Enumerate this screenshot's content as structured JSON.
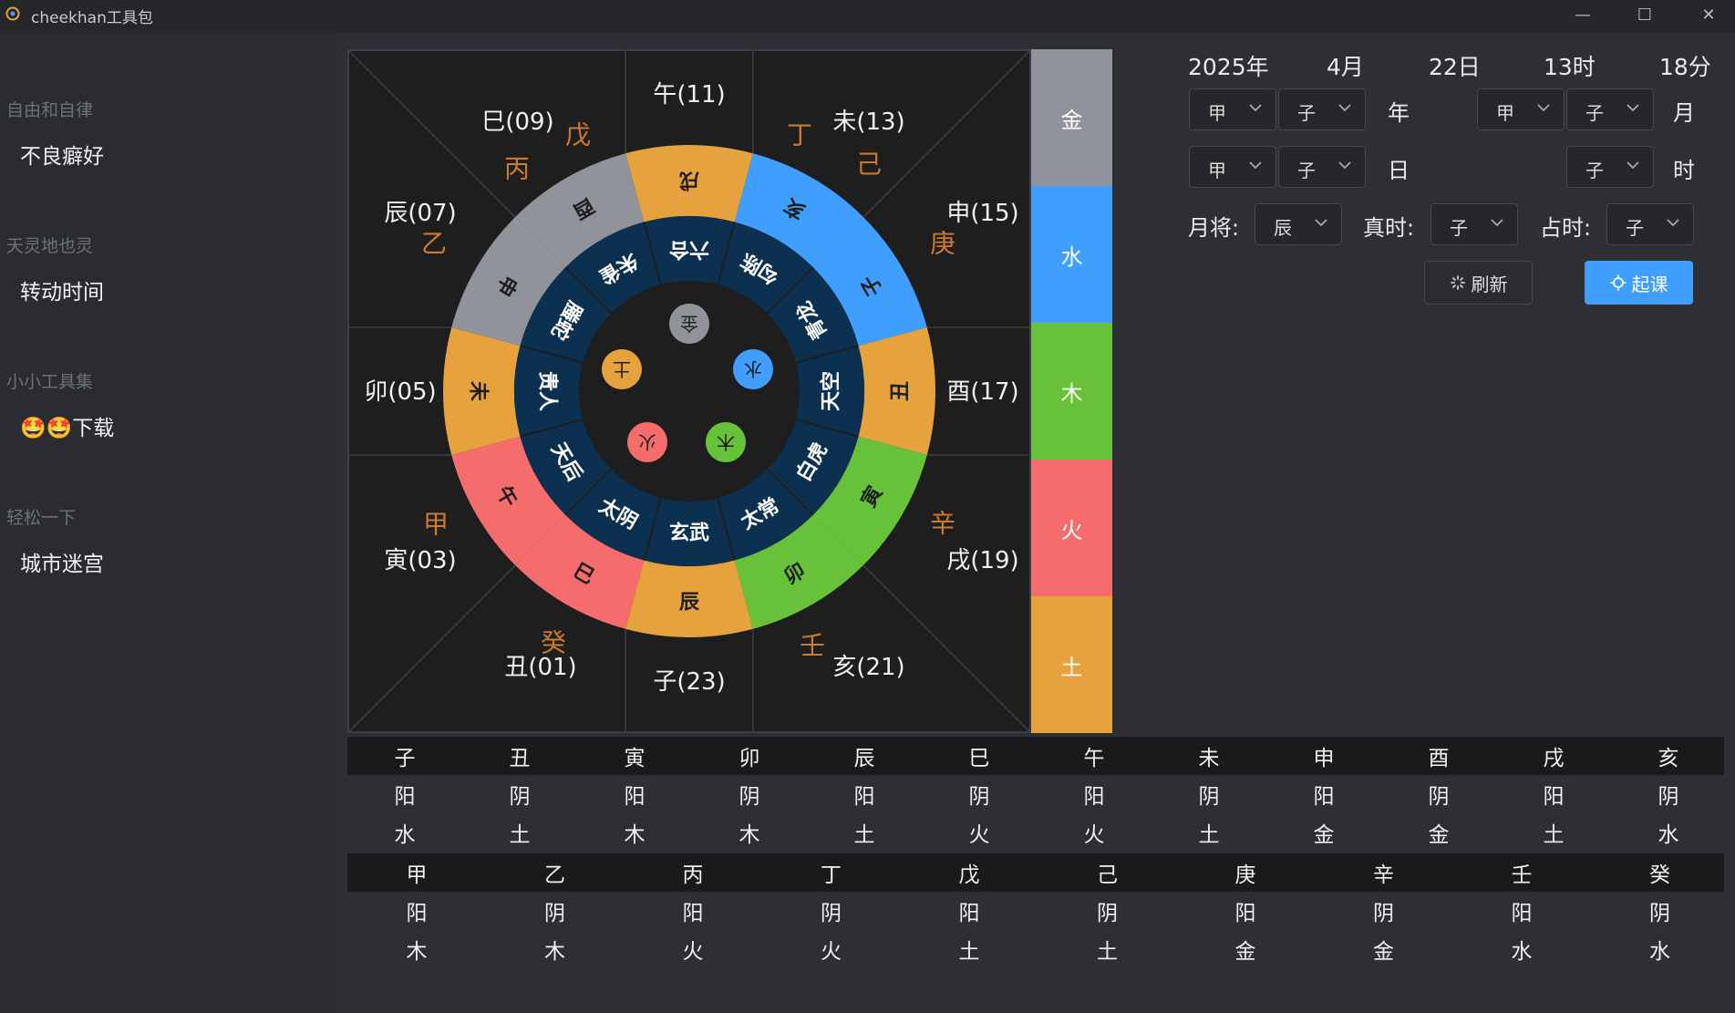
{
  "window": {
    "title": "cheekhan工具包",
    "minimize": "—",
    "maximize": "☐",
    "close": "✕"
  },
  "sidebar": {
    "groups": [
      {
        "label": "自由和自律",
        "items": [
          "不良癖好"
        ]
      },
      {
        "label": "天灵地也灵",
        "items": [
          "转动时间"
        ]
      },
      {
        "label": "小小工具集",
        "items": [
          "🤩🤩下载"
        ]
      },
      {
        "label": "轻松一下",
        "items": [
          "城市迷宫"
        ]
      }
    ]
  },
  "board": {
    "branches": [
      {
        "text": "午(11)"
      },
      {
        "text": "未(13)"
      },
      {
        "text": "申(15)"
      },
      {
        "text": "酉(17)"
      },
      {
        "text": "戌(19)"
      },
      {
        "text": "亥(21)"
      },
      {
        "text": "子(23)"
      },
      {
        "text": "丑(01)"
      },
      {
        "text": "寅(03)"
      },
      {
        "text": "卯(05)"
      },
      {
        "text": "辰(07)"
      },
      {
        "text": "巳(09)"
      }
    ],
    "stems": [
      {
        "text": "戊"
      },
      {
        "text": "丙"
      },
      {
        "text": "丁"
      },
      {
        "text": "己"
      },
      {
        "text": "庚"
      },
      {
        "text": "辛"
      },
      {
        "text": "壬"
      },
      {
        "text": "癸"
      },
      {
        "text": "甲"
      },
      {
        "text": "乙"
      }
    ],
    "outer_ring": [
      {
        "text": "戌",
        "color": "#e6a23c"
      },
      {
        "text": "亥",
        "color": "#409eff"
      },
      {
        "text": "子",
        "color": "#409eff"
      },
      {
        "text": "丑",
        "color": "#e6a23c"
      },
      {
        "text": "寅",
        "color": "#67c23a"
      },
      {
        "text": "卯",
        "color": "#67c23a"
      },
      {
        "text": "辰",
        "color": "#e6a23c"
      },
      {
        "text": "巳",
        "color": "#f56c6c"
      },
      {
        "text": "午",
        "color": "#f56c6c"
      },
      {
        "text": "未",
        "color": "#e6a23c"
      },
      {
        "text": "申",
        "color": "#909399"
      },
      {
        "text": "酉",
        "color": "#909399"
      }
    ],
    "inner_ring": [
      "六合",
      "勾陈",
      "青龙",
      "天空",
      "白虎",
      "太常",
      "玄武",
      "太阴",
      "天后",
      "贵人",
      "螣蛇",
      "朱雀"
    ],
    "elements": [
      {
        "text": "金",
        "color": "#909399"
      },
      {
        "text": "水",
        "color": "#409eff"
      },
      {
        "text": "木",
        "color": "#67c23a"
      },
      {
        "text": "火",
        "color": "#f56c6c"
      },
      {
        "text": "土",
        "color": "#e6a23c"
      }
    ]
  },
  "pillar": [
    {
      "text": "金",
      "color": "#909399"
    },
    {
      "text": "水",
      "color": "#409eff"
    },
    {
      "text": "木",
      "color": "#67c23a"
    },
    {
      "text": "火",
      "color": "#f56c6c"
    },
    {
      "text": "土",
      "color": "#e6a23c"
    }
  ],
  "datetime": {
    "year": "2025年",
    "month": "4月",
    "day": "22日",
    "hour": "13时",
    "minute": "18分"
  },
  "form": {
    "year_stem": "甲",
    "year_branch": "子",
    "year_label": "年",
    "month_stem": "甲",
    "month_branch": "子",
    "month_label": "月",
    "day_stem": "甲",
    "day_branch": "子",
    "day_label": "日",
    "hour_branch": "子",
    "hour_label": "时",
    "yuejiang_label": "月将:",
    "yuejiang_value": "辰",
    "zhenshi_label": "真时:",
    "zhenshi_value": "子",
    "zhanshi_label": "占时:",
    "zhanshi_value": "子",
    "refresh_label": "刷新",
    "start_label": "起课"
  },
  "table_branches": {
    "names": [
      "子",
      "丑",
      "寅",
      "卯",
      "辰",
      "巳",
      "午",
      "未",
      "申",
      "酉",
      "戌",
      "亥"
    ],
    "yinyang": [
      "阳",
      "阴",
      "阳",
      "阴",
      "阳",
      "阴",
      "阳",
      "阴",
      "阳",
      "阴",
      "阳",
      "阴"
    ],
    "wuxing": [
      "水",
      "土",
      "木",
      "木",
      "土",
      "火",
      "火",
      "土",
      "金",
      "金",
      "土",
      "水"
    ]
  },
  "table_stems": {
    "names": [
      "甲",
      "乙",
      "丙",
      "丁",
      "戊",
      "己",
      "庚",
      "辛",
      "壬",
      "癸"
    ],
    "yinyang": [
      "阳",
      "阴",
      "阳",
      "阴",
      "阳",
      "阴",
      "阳",
      "阴",
      "阳",
      "阴"
    ],
    "wuxing": [
      "木",
      "木",
      "火",
      "火",
      "土",
      "土",
      "金",
      "金",
      "水",
      "水"
    ]
  }
}
